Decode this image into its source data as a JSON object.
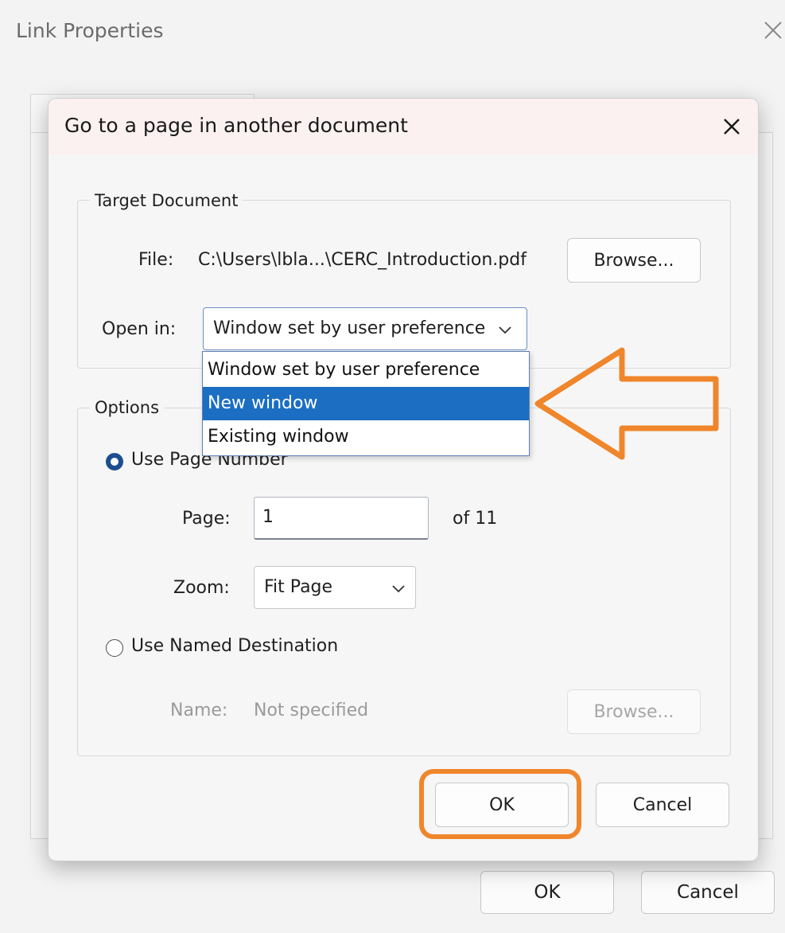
{
  "parent_dialog": {
    "title": "Link Properties",
    "ok_label": "OK",
    "cancel_label": "Cancel"
  },
  "dialog": {
    "title": "Go to a page in another document",
    "target_document": {
      "legend": "Target Document",
      "file_label": "File:",
      "file_path": "C:\\Users\\lbla...\\CERC_Introduction.pdf",
      "browse_label": "Browse...",
      "open_in_label": "Open in:",
      "open_in_value": "Window set by user preference",
      "open_in_options": [
        "Window set by user preference",
        "New window",
        "Existing window"
      ],
      "highlighted_option": "New window"
    },
    "options": {
      "legend": "Options",
      "use_page_number_label": "Use Page Number",
      "use_page_number_selected": true,
      "page_label": "Page:",
      "page_value": "1",
      "page_total": "of 11",
      "zoom_label": "Zoom:",
      "zoom_value": "Fit Page",
      "use_named_destination_label": "Use Named Destination",
      "use_named_destination_selected": false,
      "name_label": "Name:",
      "name_value": "Not specified",
      "browse_label": "Browse..."
    },
    "ok_label": "OK",
    "cancel_label": "Cancel"
  },
  "colors": {
    "highlight_blue": "#1b6ec2",
    "annotation_orange": "#f0862b",
    "radio_selected": "#1c4e8f"
  },
  "icons": {
    "close": "close-icon",
    "chevron": "chevron-down-icon"
  }
}
